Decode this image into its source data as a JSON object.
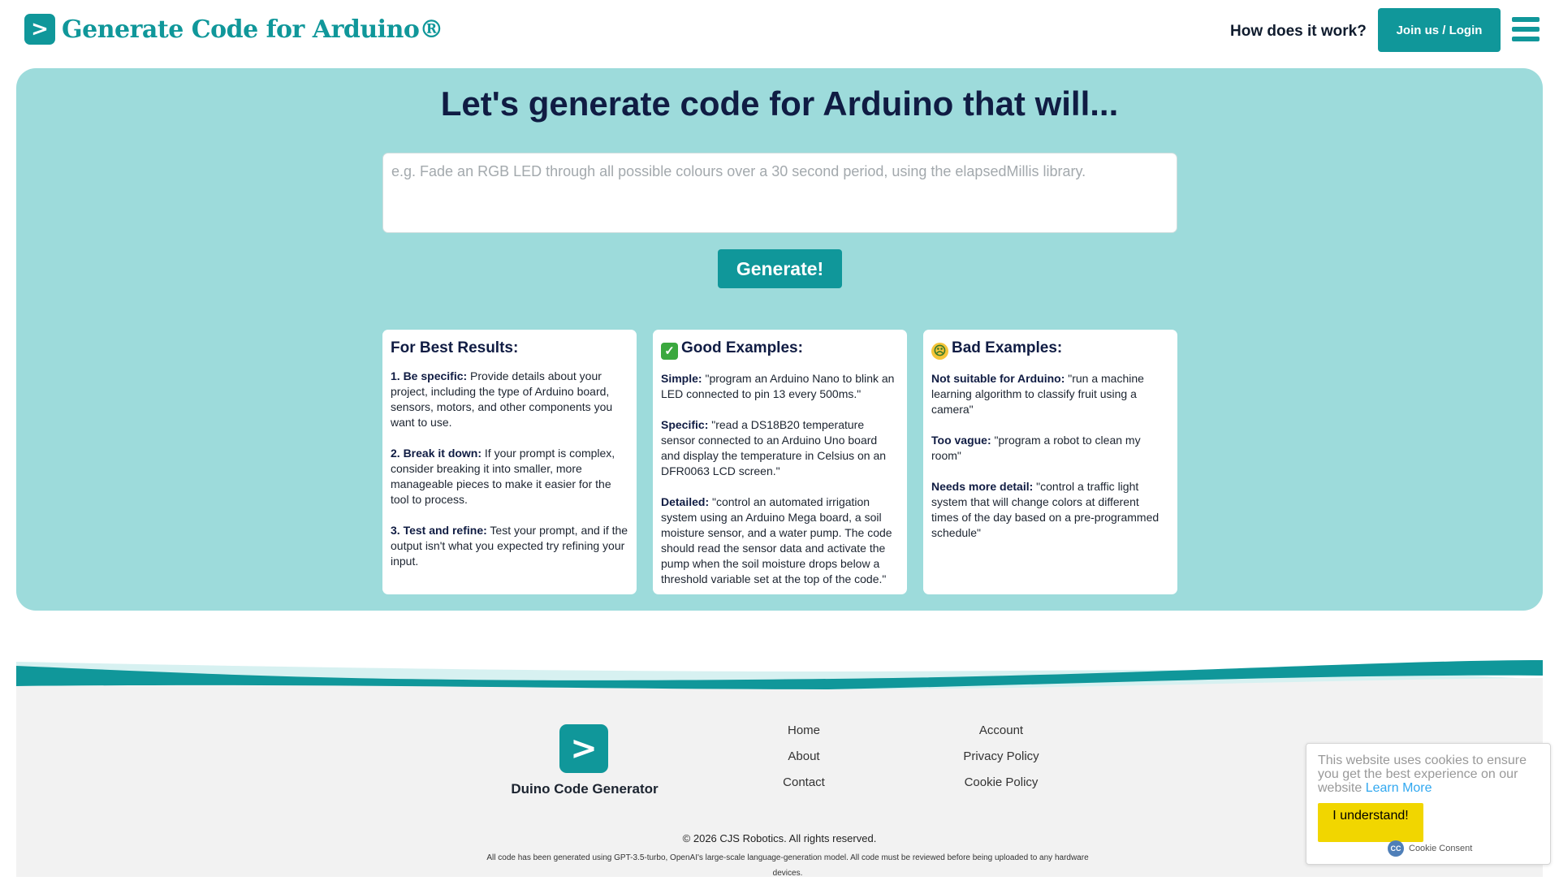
{
  "header": {
    "logo_glyph": ">",
    "title": "Generate Code for Arduino®",
    "how_link": "How does it work?",
    "join_button": "Join us / Login"
  },
  "hero": {
    "title": "Let's generate code for Arduino that will...",
    "prompt_placeholder": "e.g. Fade an RGB LED through all possible colours over a 30 second period, using the elapsedMillis library.",
    "prompt_value": "",
    "generate_button": "Generate!"
  },
  "cards": {
    "best": {
      "heading": "For Best Results:",
      "items": [
        {
          "lead": "1. Be specific:",
          "text": " Provide details about your project, including the type of Arduino board, sensors, motors, and other components you want to use."
        },
        {
          "lead": "2. Break it down:",
          "text": " If your prompt is complex, consider breaking it into smaller, more manageable pieces to make it easier for the tool to process."
        },
        {
          "lead": "3. Test and refine:",
          "text": " Test your prompt, and if the output isn't what you expected try refining your input."
        }
      ]
    },
    "good": {
      "emoji": "check-mark-icon",
      "heading": "Good Examples:",
      "items": [
        {
          "lead": "Simple:",
          "text": " \"program an Arduino Nano to blink an LED connected to pin 13 every 500ms.\""
        },
        {
          "lead": "Specific:",
          "text": " \"read a DS18B20 temperature sensor connected to an Arduino Uno board and display the temperature in Celsius on an DFR0063 LCD screen.\""
        },
        {
          "lead": "Detailed:",
          "text": " \"control an automated irrigation system using an Arduino Mega board, a soil moisture sensor, and a water pump. The code should read the sensor data and activate the pump when the soil moisture drops below a threshold variable set at the top of the code.\""
        }
      ]
    },
    "bad": {
      "emoji": "nauseated-face-icon",
      "heading": "Bad Examples:",
      "items": [
        {
          "lead": "Not suitable for Arduino:",
          "text": " \"run a machine learning algorithm to classify fruit using a camera\""
        },
        {
          "lead": "Too vague:",
          "text": " \"program a robot to clean my room\""
        },
        {
          "lead": "Needs more detail:",
          "text": " \"control a traffic light system that will change colors at different times of the day based on a pre-programmed schedule\""
        }
      ]
    }
  },
  "footer": {
    "logo_glyph": ">",
    "name": "Duino Code Generator",
    "links_left": [
      "Home",
      "About",
      "Contact"
    ],
    "links_right": [
      "Account",
      "Privacy Policy",
      "Cookie Policy"
    ],
    "copyright": "© 2026 CJS Robotics. All rights reserved.",
    "disclaimer": "All code has been generated using GPT-3.5-turbo, OpenAI's large-scale language-generation model. All code must be reviewed before being uploaded to any hardware devices."
  },
  "cookie": {
    "text": "This website uses cookies to ensure you get the best experience on our website",
    "learn_more": "Learn More",
    "button": "I understand!",
    "brand": "Cookie Consent",
    "brand_badge": "CC"
  },
  "colors": {
    "accent": "#10979a",
    "hero_bg": "#9ddbdb",
    "heading": "#101c43",
    "cookie_button": "#f1d600"
  }
}
